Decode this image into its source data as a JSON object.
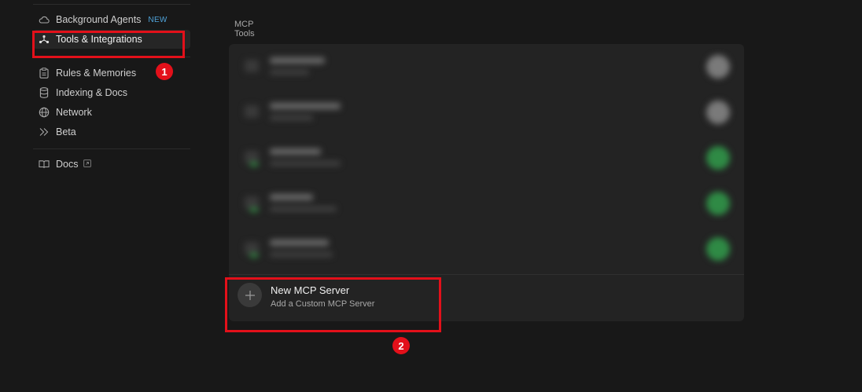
{
  "sidebar": {
    "items_group1": [
      {
        "label": "Background Agents",
        "badge": "NEW",
        "icon": "cloud-icon"
      },
      {
        "label": "Tools & Integrations",
        "icon": "hub-icon",
        "active": true
      }
    ],
    "items_group2": [
      {
        "label": "Rules & Memories",
        "icon": "clipboard-icon"
      },
      {
        "label": "Indexing & Docs",
        "icon": "database-icon"
      },
      {
        "label": "Network",
        "icon": "globe-icon"
      },
      {
        "label": "Beta",
        "icon": "double-chevron-icon"
      }
    ],
    "items_group3": [
      {
        "label": "Docs",
        "icon": "book-icon",
        "external": true
      }
    ]
  },
  "main": {
    "section_title": "MCP Tools",
    "tools_count_visible": 5,
    "tool_toggle_states": [
      "off",
      "off",
      "on",
      "on",
      "on"
    ],
    "new_server": {
      "title": "New MCP Server",
      "subtitle": "Add a Custom MCP Server",
      "icon": "plus-icon"
    }
  },
  "annotations": [
    {
      "number": "1",
      "target": "Tools & Integrations"
    },
    {
      "number": "2",
      "target": "New MCP Server"
    }
  ],
  "colors": {
    "background": "#181818",
    "panel": "#232323",
    "annotation_red": "#e3101a",
    "new_badge": "#4fa3d9",
    "toggle_on": "#2f8a45"
  }
}
